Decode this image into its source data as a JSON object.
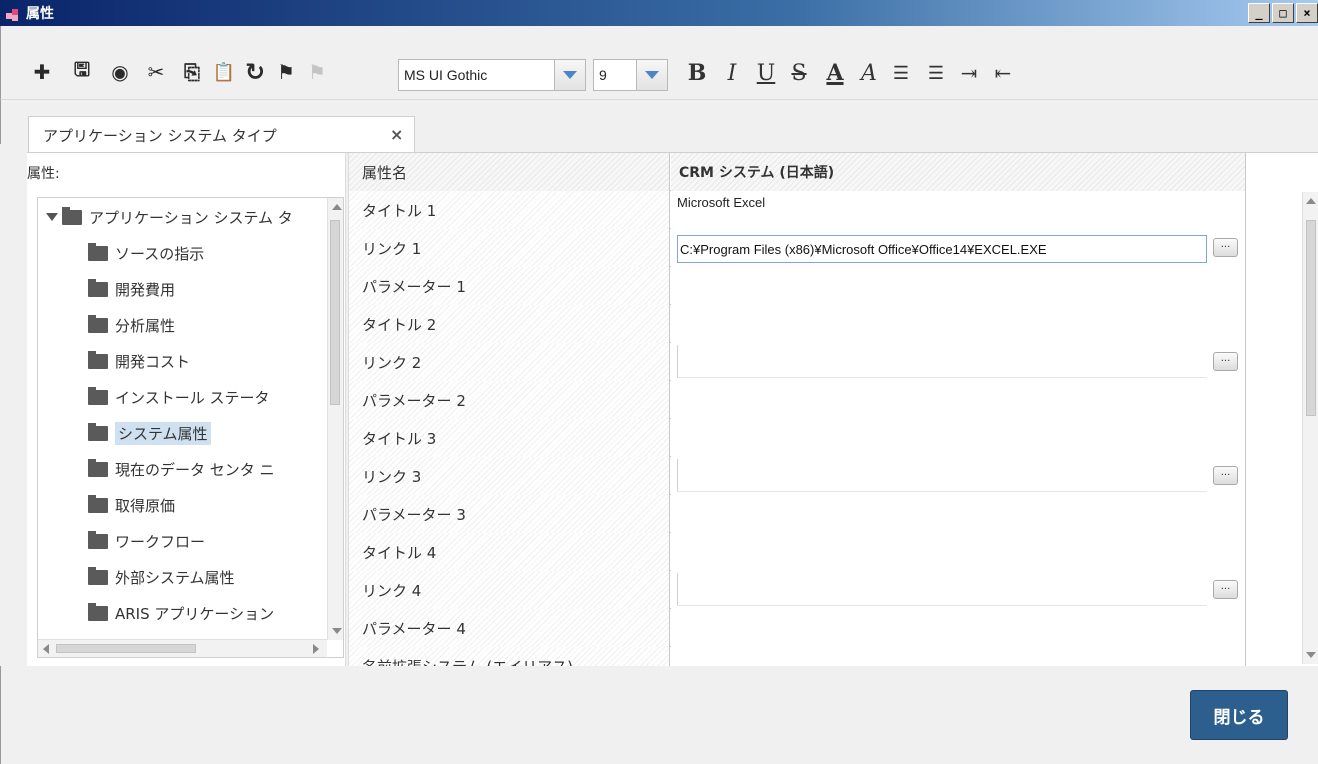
{
  "window": {
    "title": "属性",
    "min": "_",
    "max": "□",
    "close": "×"
  },
  "toolbar": {
    "font_name": "MS UI Gothic",
    "font_size": "9",
    "icons": [
      "plus-icon",
      "save-icon",
      "globe-icon",
      "cut-icon",
      "copy-icon",
      "paste-icon",
      "redo-icon",
      "undo-icon",
      "disabled-arrow-icon"
    ],
    "glyphs": {
      "add": "✚",
      "save": "🖫",
      "globe": "◉",
      "cut": "✂",
      "copy": "⎘",
      "paste": "📋",
      "refresh": "↻",
      "flag": "⚑",
      "flag2": "⚑",
      "bold": "B",
      "italic": "I",
      "underline": "U",
      "strike": "S",
      "fontcolor": "A",
      "highlight": "A",
      "olist": "☰",
      "ulist": "☰",
      "indent": "⇥",
      "outdent": "⇤"
    }
  },
  "tab": {
    "label": "アプリケーション システム タイプ",
    "close": "×"
  },
  "left": {
    "label": "属性:",
    "tree": [
      "アプリケーション システム タ",
      "ソースの指示",
      "開発費用",
      "分析属性",
      "開発コスト",
      "インストール ステータ",
      "システム属性",
      "現在のデータ センタ ニ",
      "取得原価",
      "ワークフロー",
      "外部システム属性",
      "ARIS アプリケーション"
    ]
  },
  "grid": {
    "header": {
      "name": "属性名",
      "value": "CRM システム (日本語)"
    },
    "rows": [
      {
        "name": "タイトル 1",
        "value": "Microsoft Excel"
      },
      {
        "name": "リンク 1",
        "value": "C:¥Program Files (x86)¥Microsoft Office¥Office14¥EXCEL.EXE"
      },
      {
        "name": "パラメーター 1",
        "value": ""
      },
      {
        "name": "タイトル 2",
        "value": ""
      },
      {
        "name": "リンク 2",
        "value": ""
      },
      {
        "name": "パラメーター 2",
        "value": ""
      },
      {
        "name": "タイトル 3",
        "value": ""
      },
      {
        "name": "リンク 3",
        "value": ""
      },
      {
        "name": "パラメーター 3",
        "value": ""
      },
      {
        "name": "タイトル 4",
        "value": ""
      },
      {
        "name": "リンク 4",
        "value": ""
      },
      {
        "name": "パラメーター 4",
        "value": ""
      },
      {
        "name": "名前拡張システム (エイリアス)",
        "value": ""
      }
    ],
    "ellipsis": "..."
  },
  "footer": {
    "close_label": "閉じる"
  }
}
